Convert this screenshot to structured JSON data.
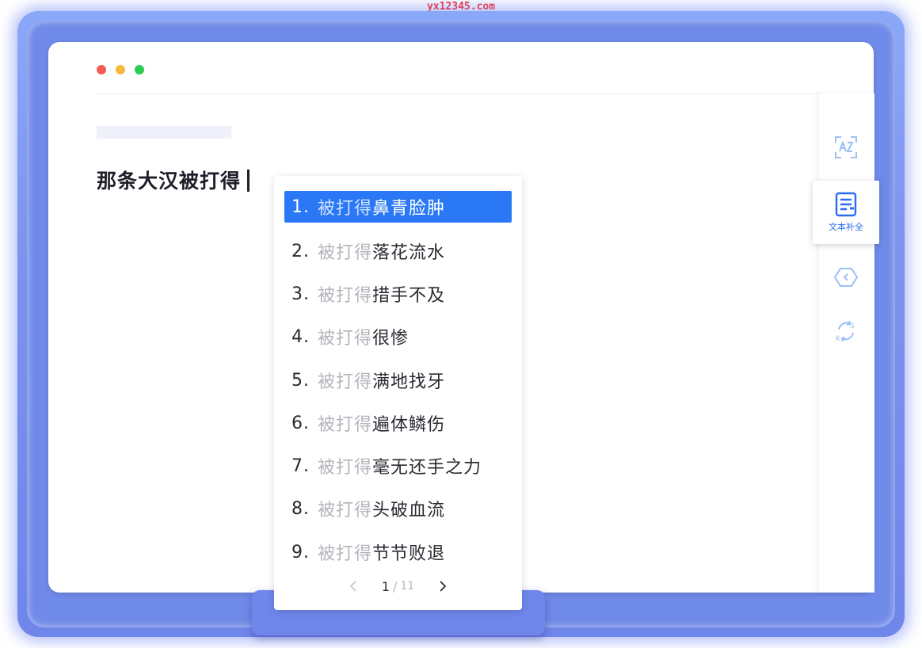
{
  "watermark": "yx12345.com",
  "editor": {
    "text": "那条大汉被打得"
  },
  "tools": {
    "active_label": "文本补全",
    "icons": [
      "ocr-scan-icon",
      "text-complete-icon",
      "tag-icon",
      "sync-sk-icon"
    ]
  },
  "suggestions": {
    "prefix": "被打得",
    "items": [
      {
        "num": "1.",
        "rest": "鼻青脸肿"
      },
      {
        "num": "2.",
        "rest": "落花流水"
      },
      {
        "num": "3.",
        "rest": "措手不及"
      },
      {
        "num": "4.",
        "rest": "很惨"
      },
      {
        "num": "5.",
        "rest": "满地找牙"
      },
      {
        "num": "6.",
        "rest": "遍体鳞伤"
      },
      {
        "num": "7.",
        "rest": "毫无还手之力"
      },
      {
        "num": "8.",
        "rest": "头破血流"
      },
      {
        "num": "9.",
        "rest": "节节败退"
      }
    ],
    "selected_index": 0
  },
  "pager": {
    "current": "1",
    "separator": "/",
    "total": "11"
  },
  "colors": {
    "accent": "#2a78f5",
    "glow": "#7d92ee",
    "dot_red": "#f25c54",
    "dot_yellow": "#f6b93b",
    "dot_green": "#2ecc52"
  }
}
